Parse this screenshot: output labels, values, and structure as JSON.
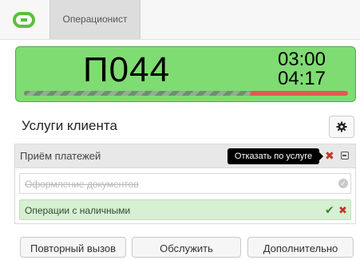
{
  "header": {
    "logo_icon": "ring-logo-icon",
    "tab_label": "Операционист"
  },
  "ticket": {
    "number": "П044",
    "timer_primary": "03:00",
    "timer_secondary": "04:17",
    "progress_fraction": 0.7,
    "bg_color": "#7fdc72"
  },
  "services": {
    "title": "Услуги клиента",
    "settings_icon": "gear-icon",
    "group": {
      "label": "Приём платежей",
      "tooltip": "Отказать по услуге"
    },
    "items": [
      {
        "label": "Оформление документов",
        "status": "cancelled"
      },
      {
        "label": "Операции с наличными",
        "status": "active"
      }
    ]
  },
  "actions": {
    "recall": "Повторный вызов",
    "serve": "Обслужить",
    "more": "Дополнительно"
  }
}
